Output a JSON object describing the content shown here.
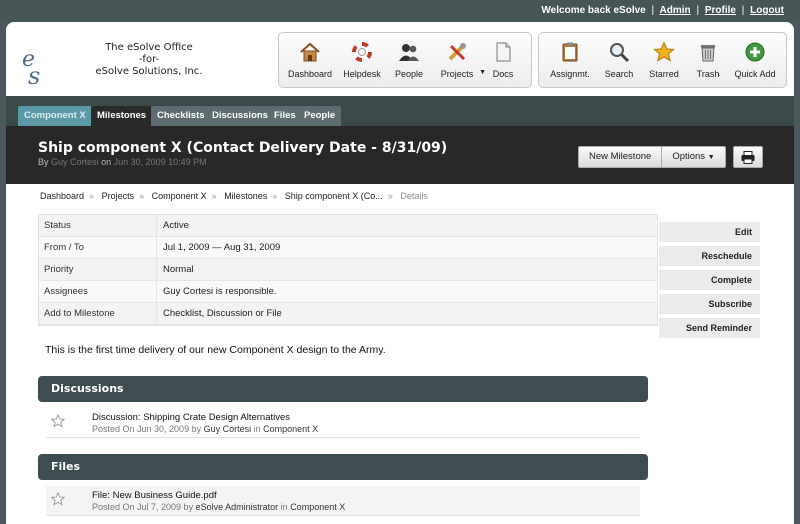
{
  "user_nav": {
    "welcome": "Welcome back eSolve",
    "links": [
      "Admin",
      "Profile",
      "Logout"
    ]
  },
  "company": {
    "line1": "The eSolve Office",
    "line2": "-for-",
    "line3": "eSolve Solutions, Inc."
  },
  "toolbar_main": [
    {
      "label": "Dashboard",
      "icon": "house-icon"
    },
    {
      "label": "Helpdesk",
      "icon": "lifebuoy-icon"
    },
    {
      "label": "People",
      "icon": "people-icon"
    },
    {
      "label": "Projects",
      "icon": "tools-icon"
    },
    {
      "label": "Docs",
      "icon": "document-icon"
    }
  ],
  "toolbar_secondary": [
    {
      "label": "Assignmt.",
      "icon": "clipboard-icon"
    },
    {
      "label": "Search",
      "icon": "magnifier-icon"
    },
    {
      "label": "Starred",
      "icon": "star-icon"
    },
    {
      "label": "Trash",
      "icon": "trash-icon"
    },
    {
      "label": "Quick Add",
      "icon": "plus-circle-icon"
    }
  ],
  "tabs": [
    "Component X",
    "Milestones",
    "Checklists",
    "Discussions",
    "Files",
    "People"
  ],
  "page": {
    "title": "Ship component X (Contact Delivery Date - 8/31/09)",
    "by": "By",
    "author": "Guy Cortesi",
    "on": "on",
    "date": "Jun 30, 2009 10:49 PM"
  },
  "header_buttons": {
    "new_milestone": "New Milestone",
    "options": "Options"
  },
  "breadcrumb": [
    "Dashboard",
    "Projects",
    "Component X",
    "Milestones",
    "Ship component X (Co...",
    "Details"
  ],
  "details": [
    {
      "key": "Status",
      "value": "Active"
    },
    {
      "key": "From / To",
      "value": "Jul 1, 2009 — Aug 31, 2009"
    },
    {
      "key": "Priority",
      "value": "Normal"
    },
    {
      "key": "Assignees",
      "value": "Guy Cortesi is responsible."
    },
    {
      "key": "Add to Milestone",
      "value": "Checklist, Discussion or File"
    }
  ],
  "actions": [
    "Edit",
    "Reschedule",
    "Complete",
    "Subscribe",
    "Send Reminder"
  ],
  "description": "This is the first time delivery of our new Component X design to the Army.",
  "discussions": {
    "heading": "Discussions",
    "items": [
      {
        "title": "Discussion: Shipping Crate Design Alternatives",
        "posted": "Posted On Jun 30, 2009 by",
        "author": "Guy Cortesi",
        "in": "in",
        "project": "Component X"
      }
    ]
  },
  "files": {
    "heading": "Files",
    "items": [
      {
        "title": "File: New Business Guide.pdf",
        "posted": "Posted On Jul 7, 2009 by",
        "author": "eSolve Administrator",
        "in": "in",
        "project": "Component X"
      }
    ]
  },
  "colors": {
    "frame": "#465657",
    "tab_selected": "#5a9aa6",
    "title_bar": "#282828",
    "section_header": "#3e4d4f"
  }
}
